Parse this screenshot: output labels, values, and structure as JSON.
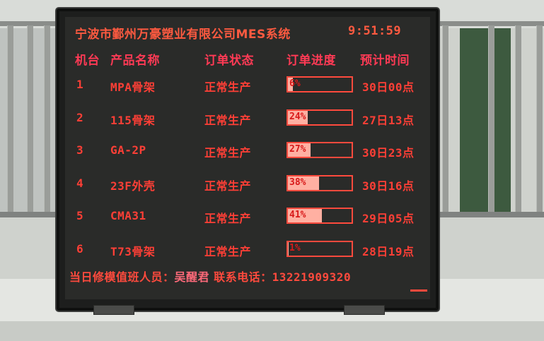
{
  "sign": {
    "title": "宁波市鄞州万豪塑业有限公司MES系统",
    "clock": "9:51:59",
    "headers": {
      "machine": "机台",
      "product": "产品名称",
      "status": "订单状态",
      "progress": "订单进度",
      "eta": "预计时间"
    },
    "rows": [
      {
        "machine": "1",
        "product": "MPA骨架",
        "status": "正常生产",
        "progress_label": "6%",
        "progress": 6,
        "eta": "30日00点"
      },
      {
        "machine": "2",
        "product": "115骨架",
        "status": "正常生产",
        "progress_label": "24%",
        "progress": 24,
        "eta": "27日13点"
      },
      {
        "machine": "3",
        "product": "GA-2P",
        "status": "正常生产",
        "progress_label": "27%",
        "progress": 27,
        "eta": "30日23点"
      },
      {
        "machine": "4",
        "product": "23F外壳",
        "status": "正常生产",
        "progress_label": "38%",
        "progress": 38,
        "eta": "30日16点"
      },
      {
        "machine": "5",
        "product": "CMA31",
        "status": "正常生产",
        "progress_label": "41%",
        "progress": 41,
        "eta": "29日05点"
      },
      {
        "machine": "6",
        "product": "T73骨架",
        "status": "正常生产",
        "progress_label": "1%",
        "progress": 1,
        "eta": "28日19点"
      }
    ],
    "footer": {
      "duty_label": "当日修模值班人员：",
      "duty_name": "吴醒君",
      "phone_label": " 联系电话：",
      "phone": "13221909320"
    }
  },
  "colors": {
    "led_red": "#ff4a3d",
    "bar_fill": "#ffb0a2",
    "screen_bg": "#2a2b29"
  }
}
